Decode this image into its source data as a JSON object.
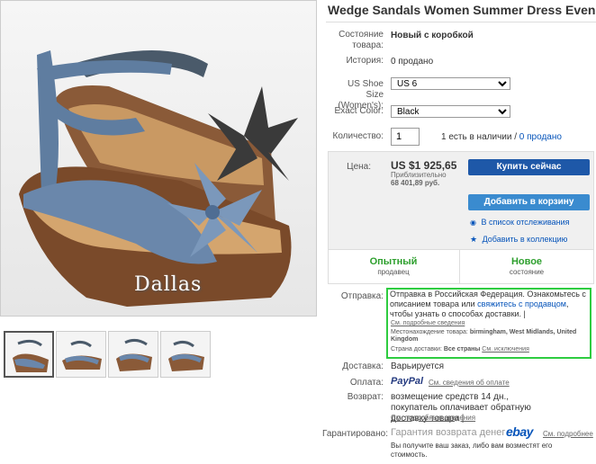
{
  "product": {
    "title": "Wedge Sandals Women Summer Dress Evening",
    "watermark": "Dallas",
    "thumbnail_count": 4
  },
  "details": {
    "condition_label": "Состояние товара:",
    "condition_value": "Новый с коробкой",
    "history_label": "История:",
    "history_value": "0 продано",
    "size_label": "US Shoe Size (Women's):",
    "size_value": "US 6",
    "color_label": "Exact Color:",
    "color_value": "Black",
    "qty_label": "Количество:",
    "qty_value": "1",
    "availability": "1 есть в наличии /",
    "sold_link": "0 продано"
  },
  "price": {
    "label": "Цена:",
    "amount": "US $1 925,65",
    "approx_label": "Приблизительно",
    "approx_value": "68 401,89 руб.",
    "buy_now": "Купить сейчас",
    "add_to_cart": "Добавить в корзину",
    "watch": "В список отслеживания",
    "collection": "Добавить в коллекцию"
  },
  "seller": {
    "seller_title": "Опытный",
    "seller_sub": "продавец",
    "cond_title": "Новое",
    "cond_sub": "состояние"
  },
  "shipping": {
    "label": "Отправка:",
    "text_before": "Отправка в Российская Федерация. Ознакомьтесь с описанием товара или ",
    "contact_link": "свяжитесь с продавцом",
    "text_after": ", чтобы узнать о способах доставки. |",
    "details_link": "См. подробные сведения",
    "location_label": "Местонахождение товара:",
    "location_value": "birmingham, West Midlands, United Kingdom",
    "countries_label": "Страна доставки:",
    "countries_value": "Все страны",
    "exclusions_link": "См. исключения"
  },
  "delivery": {
    "label": "Доставка:",
    "value": "Варьируется"
  },
  "payment": {
    "label": "Оплата:",
    "paypal": "PayPal",
    "details_link": "См. сведения об оплате"
  },
  "returns": {
    "label": "Возврат:",
    "value": "возмещение средств 14 дн., покупатель оплачивает обратную доставку товара |",
    "details_link": "См. подробные сведения"
  },
  "guarantee": {
    "label": "Гарантировано:",
    "text": "Гарантия возврата денег",
    "ebay": "ebay",
    "details_link": "См. подробнее",
    "note": "Вы получите ваш заказ, либо вам возместят его стоимость."
  },
  "colors": {
    "buy_now": "#1e58a8",
    "add_to_cart": "#3a8bcf",
    "condition_green": "#2d9f2d",
    "highlight": "#2ecc40",
    "link": "#0654ba"
  }
}
